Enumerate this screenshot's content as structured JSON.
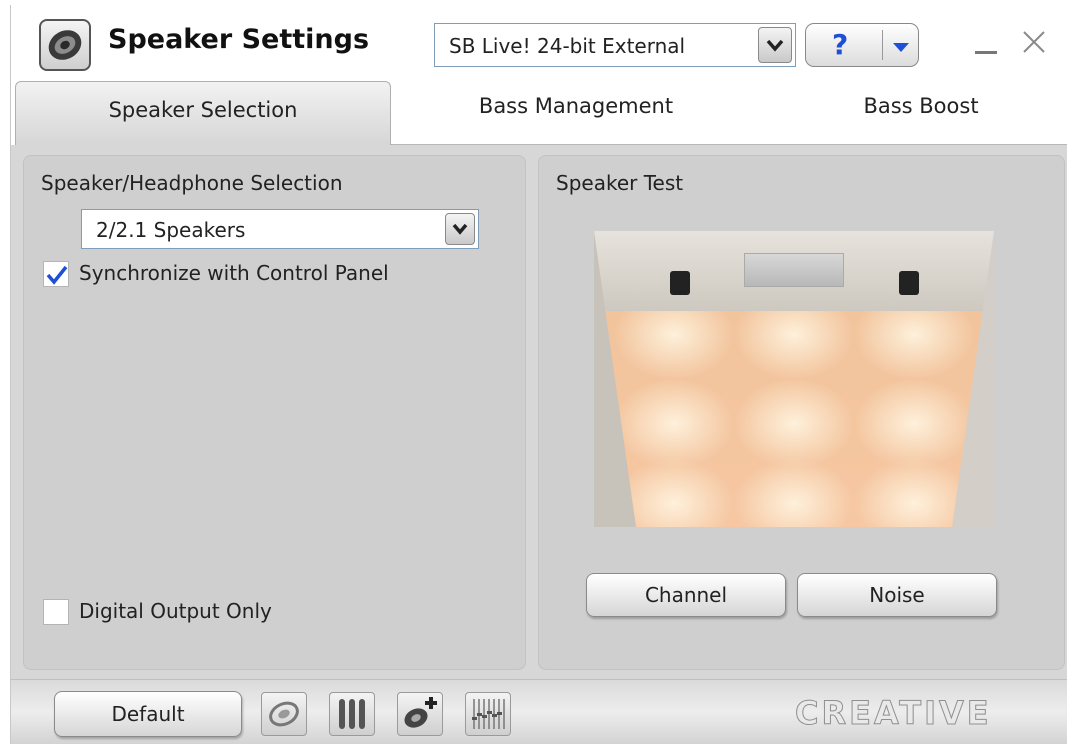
{
  "window": {
    "title": "Speaker Settings",
    "device_selected": "SB Live! 24-bit External",
    "help_label": "?"
  },
  "tabs": [
    {
      "label": "Speaker Selection",
      "active": true
    },
    {
      "label": "Bass Management",
      "active": false
    },
    {
      "label": "Bass Boost",
      "active": false
    }
  ],
  "left_panel": {
    "title": "Speaker/Headphone Selection",
    "speaker_selected": "2/2.1 Speakers",
    "sync_label": "Synchronize with Control Panel",
    "sync_checked": true,
    "digital_label": "Digital Output Only",
    "digital_checked": false
  },
  "right_panel": {
    "title": "Speaker Test",
    "channel_label": "Channel",
    "noise_label": "Noise"
  },
  "bottom": {
    "default_label": "Default",
    "logo": "CREATIVE",
    "icons": [
      "speaker-tool-icon",
      "mixer-tool-icon",
      "add-speaker-icon",
      "equalizer-tool-icon"
    ]
  },
  "colors": {
    "accent": "#1e4fd6",
    "panel": "#cfcfcf",
    "floor": "#f4c59f"
  }
}
